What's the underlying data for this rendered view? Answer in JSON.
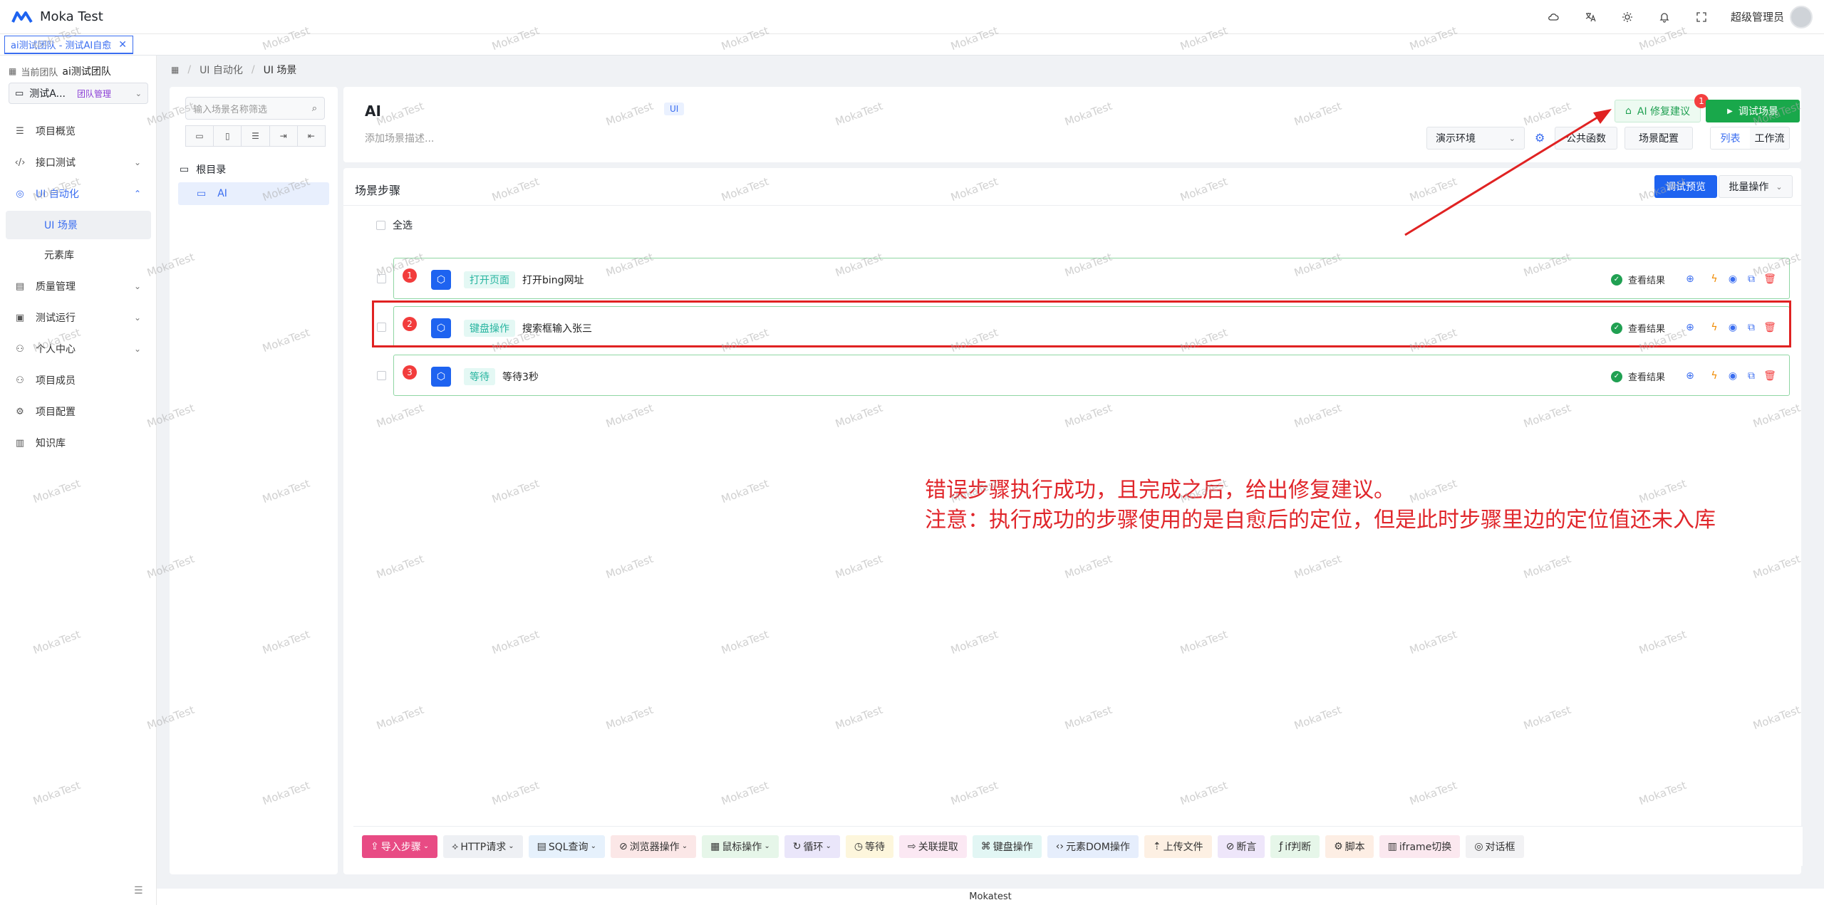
{
  "app": {
    "title": "Moka Test"
  },
  "topbar": {
    "user": "超级管理员",
    "icons": [
      "cloud-icon",
      "translate-icon",
      "sun-icon",
      "bell-icon",
      "fullscreen-icon"
    ]
  },
  "tabs": [
    {
      "label": "ai测试团队 - 测试AI自愈"
    }
  ],
  "sidebar": {
    "team_prefix": "当前团队",
    "team_name": "ai测试团队",
    "project": "测试A...",
    "team_manage": "团队管理",
    "items": [
      {
        "label": "项目概览"
      },
      {
        "label": "接口测试"
      },
      {
        "label": "UI 自动化"
      },
      {
        "label": "UI 场景"
      },
      {
        "label": "元素库"
      },
      {
        "label": "质量管理"
      },
      {
        "label": "测试运行"
      },
      {
        "label": "个人中心"
      },
      {
        "label": "项目成员"
      },
      {
        "label": "项目配置"
      },
      {
        "label": "知识库"
      }
    ]
  },
  "breadcrumb": {
    "items": [
      "UI 自动化",
      "UI 场景"
    ],
    "sep": "/"
  },
  "tree": {
    "search_placeholder": "输入场景名称筛选",
    "root": "根目录",
    "node": "AI"
  },
  "scene": {
    "title": "AI",
    "tag": "UI",
    "desc_placeholder": "添加场景描述...",
    "ai_fix_label": "AI 修复建议",
    "ai_fix_badge": "1",
    "run_label": "调试场景",
    "env": "演示环境",
    "public_fn": "公共函数",
    "scene_config": "场景配置",
    "view_list": "列表",
    "view_flow": "工作流"
  },
  "steps": {
    "title": "场景步骤",
    "preview": "调试预览",
    "batch": "批量操作",
    "select_all": "全选",
    "result_label": "查看结果",
    "items": [
      {
        "num": "1",
        "type": "打开页面",
        "name": "打开bing网址"
      },
      {
        "num": "2",
        "type": "键盘操作",
        "name": "搜索框输入张三"
      },
      {
        "num": "3",
        "type": "等待",
        "name": "等待3秒"
      }
    ]
  },
  "annotation": {
    "line1": "错误步骤执行成功，且完成之后，给出修复建议。",
    "line2": "注意：执行成功的步骤使用的是自愈后的定位，但是此时步骤里边的定位值还未入库"
  },
  "bottom_actions": [
    {
      "label": "导入步骤",
      "bg": "#e84b84",
      "fg": "#ffffff"
    },
    {
      "label": "HTTP请求",
      "bg": "#eef0f4",
      "fg": "#333333"
    },
    {
      "label": "SQL查询",
      "bg": "#e6f1fc",
      "fg": "#333333"
    },
    {
      "label": "浏览器操作",
      "bg": "#fbe7e7",
      "fg": "#333333"
    },
    {
      "label": "鼠标操作",
      "bg": "#e6f6e9",
      "fg": "#333333"
    },
    {
      "label": "循环",
      "bg": "#eae6fa",
      "fg": "#333333"
    },
    {
      "label": "等待",
      "bg": "#fdf6dc",
      "fg": "#333333"
    },
    {
      "label": "关联提取",
      "bg": "#fbe8f3",
      "fg": "#333333"
    },
    {
      "label": "键盘操作",
      "bg": "#e2f6f4",
      "fg": "#333333"
    },
    {
      "label": "元素DOM操作",
      "bg": "#e6eefc",
      "fg": "#333333"
    },
    {
      "label": "上传文件",
      "bg": "#fdf0e3",
      "fg": "#333333"
    },
    {
      "label": "断言",
      "bg": "#eee6fa",
      "fg": "#333333"
    },
    {
      "label": "if判断",
      "bg": "#e6f6e9",
      "fg": "#333333"
    },
    {
      "label": "脚本",
      "bg": "#fdeee4",
      "fg": "#333333"
    },
    {
      "label": "iframe切换",
      "bg": "#fbe8ef",
      "fg": "#333333"
    },
    {
      "label": "对话框",
      "bg": "#f2f2f4",
      "fg": "#333333"
    }
  ],
  "footer": {
    "text": "Mokatest"
  },
  "watermark": "MokaTest",
  "colors": {
    "primary": "#3a6df0",
    "success": "#19a84b",
    "danger": "#e02222"
  }
}
